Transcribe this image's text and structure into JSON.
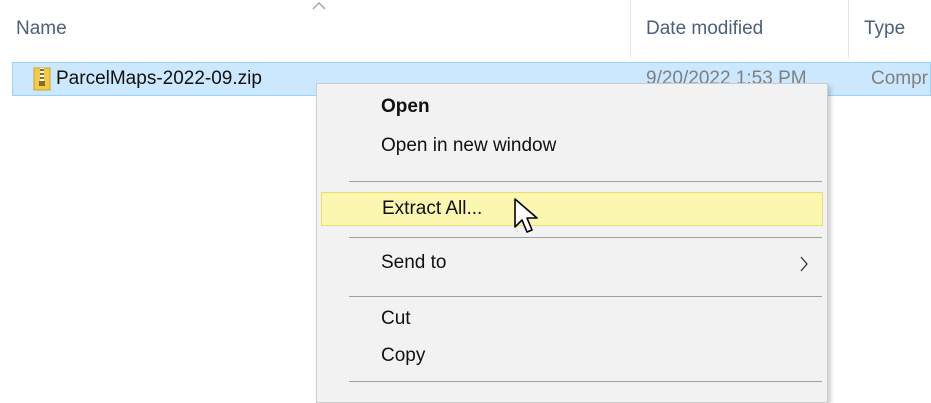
{
  "columns": {
    "name": "Name",
    "date_modified": "Date modified",
    "type": "Type"
  },
  "file": {
    "name": "ParcelMaps-2022-09.zip",
    "date_modified": "9/20/2022 1:53 PM",
    "type": "Compr",
    "icon": "zip-folder-icon"
  },
  "context_menu": {
    "items": [
      {
        "label": "Open",
        "bold": true
      },
      {
        "label": "Open in new window"
      },
      {
        "label": "Extract All...",
        "highlighted": true
      },
      {
        "label": "Send to",
        "has_submenu": true
      },
      {
        "label": "Cut"
      },
      {
        "label": "Copy"
      }
    ]
  },
  "colors": {
    "selection": "#cce8ff",
    "highlight": "#fbf6b0",
    "header_text": "#4c607a"
  }
}
